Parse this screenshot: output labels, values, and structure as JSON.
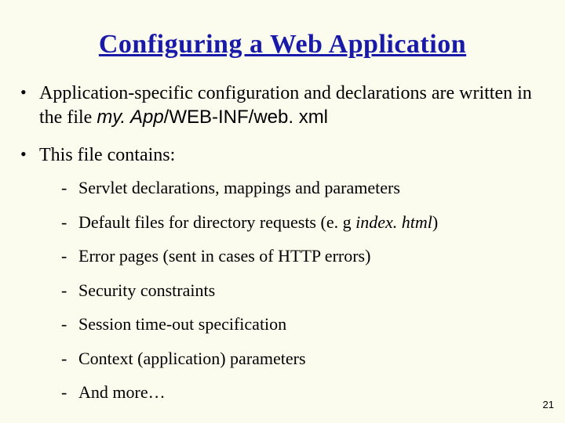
{
  "title": "Configuring a Web Application",
  "bullets": {
    "b1_pre": "Application-specific configuration and declarations are written in the file  ",
    "b1_path_ital": "my. App",
    "b1_path_rest": "/WEB-INF/web. xml",
    "b2": "This file contains:"
  },
  "sub": {
    "s1": "Servlet declarations, mappings and parameters",
    "s2_pre": "Default files for directory requests (e. g ",
    "s2_file": "index. html",
    "s2_post": ")",
    "s3": "Error pages (sent in cases of HTTP errors)",
    "s4": "Security constraints",
    "s5": "Session time-out specification",
    "s6": "Context (application) parameters",
    "s7": "And more…"
  },
  "page_number": "21"
}
